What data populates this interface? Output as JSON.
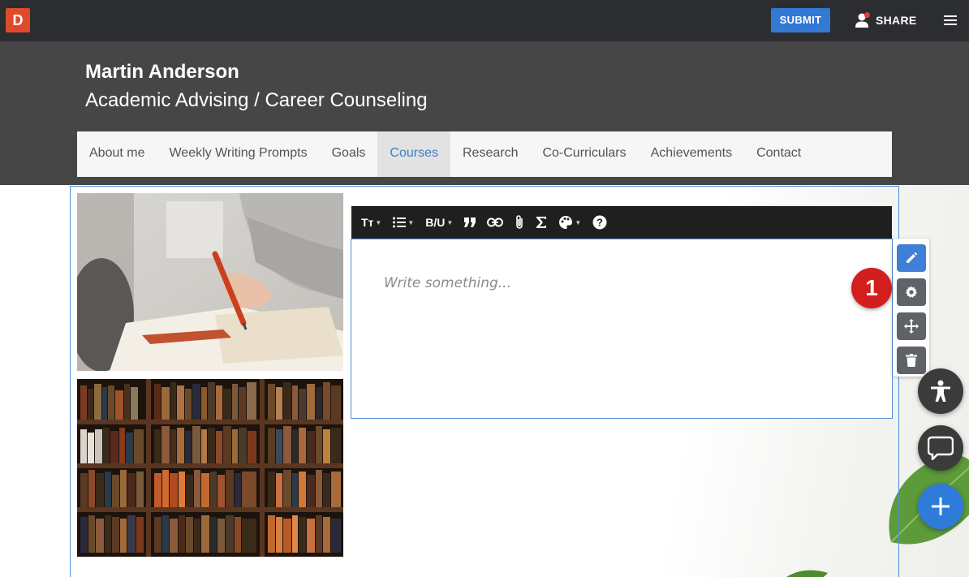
{
  "app": {
    "logo_letter": "D",
    "submit_label": "SUBMIT",
    "share_label": "SHARE"
  },
  "header": {
    "name": "Martin Anderson",
    "subtitle": "Academic Advising / Career Counseling"
  },
  "nav": {
    "items": [
      {
        "label": "About me",
        "active": false
      },
      {
        "label": "Weekly Writing Prompts",
        "active": false
      },
      {
        "label": "Goals",
        "active": false
      },
      {
        "label": "Courses",
        "active": true
      },
      {
        "label": "Research",
        "active": false
      },
      {
        "label": "Co-Curriculars",
        "active": false
      },
      {
        "label": "Achievements",
        "active": false
      },
      {
        "label": "Contact",
        "active": false
      }
    ]
  },
  "editor": {
    "placeholder": "Write something...",
    "toolbar": {
      "text_size": "Tт",
      "bold_underline": "B/U"
    }
  },
  "callout": {
    "number": "1"
  },
  "colors": {
    "topbar": "#2c2d30",
    "header": "#464646",
    "accent": "#3279d4",
    "badge": "#d41d1d",
    "active_nav_text": "#3d7fc1"
  },
  "icons": [
    "text-size-icon",
    "list-icon",
    "bold-underline-icon",
    "quote-icon",
    "link-icon",
    "attachment-icon",
    "sigma-icon",
    "palette-icon",
    "help-icon",
    "edit-icon",
    "gear-icon",
    "move-icon",
    "trash-icon",
    "accessibility-icon",
    "chat-icon",
    "plus-icon",
    "menu-icon",
    "person-icon"
  ]
}
